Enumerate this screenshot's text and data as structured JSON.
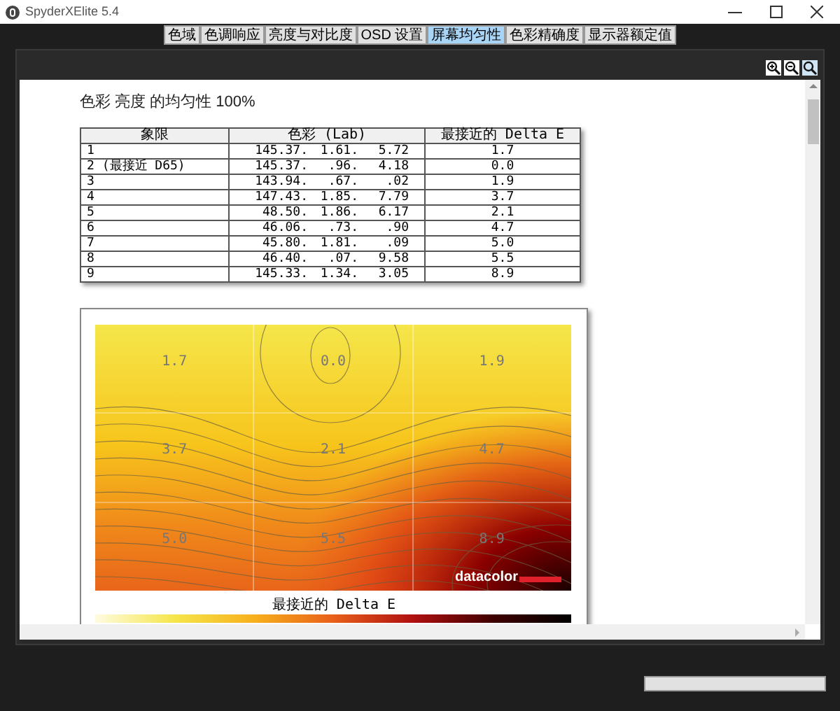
{
  "window": {
    "title": "SpyderXElite 5.4"
  },
  "tabs": [
    {
      "label": "色域",
      "selected": false
    },
    {
      "label": "色调响应",
      "selected": false
    },
    {
      "label": "亮度与对比度",
      "selected": false
    },
    {
      "label": "OSD 设置",
      "selected": false
    },
    {
      "label": "屏幕均匀性",
      "selected": true
    },
    {
      "label": "色彩精确度",
      "selected": false
    },
    {
      "label": "显示器额定值",
      "selected": false
    }
  ],
  "report": {
    "title": "色彩 亮度 的均匀性 100%",
    "table": {
      "columns": [
        "象限",
        "色彩 (Lab)",
        "最接近的 Delta E"
      ],
      "rows": [
        {
          "quadrant": "1",
          "lab": [
            "145.37.",
            "1.61.",
            "5.72"
          ],
          "delta_e": "1.7"
        },
        {
          "quadrant": "2 (最接近 D65)",
          "lab": [
            "145.37.",
            ".96.",
            "4.18"
          ],
          "delta_e": "0.0"
        },
        {
          "quadrant": "3",
          "lab": [
            "143.94.",
            ".67.",
            ".02"
          ],
          "delta_e": "1.9"
        },
        {
          "quadrant": "4",
          "lab": [
            "147.43.",
            "1.85.",
            "7.79"
          ],
          "delta_e": "3.7"
        },
        {
          "quadrant": "5",
          "lab": [
            "48.50.",
            "1.86.",
            "6.17"
          ],
          "delta_e": "2.1"
        },
        {
          "quadrant": "6",
          "lab": [
            "46.06.",
            ".73.",
            ".90"
          ],
          "delta_e": "4.7"
        },
        {
          "quadrant": "7",
          "lab": [
            "45.80.",
            "1.81.",
            ".09"
          ],
          "delta_e": "5.0"
        },
        {
          "quadrant": "8",
          "lab": [
            "46.40.",
            ".07.",
            "9.58"
          ],
          "delta_e": "5.5"
        },
        {
          "quadrant": "9",
          "lab": [
            "145.33.",
            "1.34.",
            "3.05"
          ],
          "delta_e": "8.9"
        }
      ]
    },
    "heatmap": {
      "cells": [
        "1.7",
        "0.0",
        "1.9",
        "3.7",
        "2.1",
        "4.7",
        "5.0",
        "5.5",
        "8.9"
      ],
      "logo": "datacolor",
      "legend_title": "最接近的 Delta E"
    }
  }
}
